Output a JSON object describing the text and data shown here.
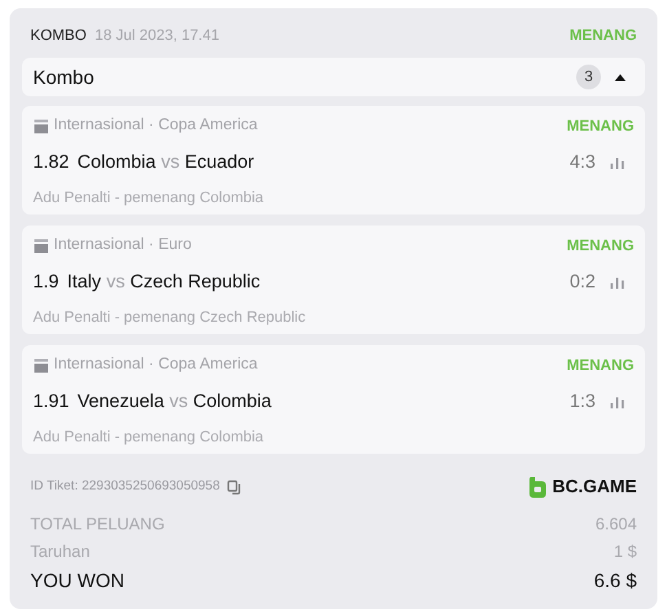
{
  "header": {
    "type": "KOMBO",
    "date": "18 Jul 2023, 17.41",
    "status": "MENANG"
  },
  "combo_bar": {
    "title": "Kombo",
    "count": "3",
    "expanded": true
  },
  "matches": [
    {
      "league": "Internasional · Copa America",
      "status": "MENANG",
      "odds": "1.82",
      "home": "Colombia",
      "vs": "vs",
      "away": "Ecuador",
      "score": "4:3",
      "market": "Adu Penalti - pemenang Colombia"
    },
    {
      "league": "Internasional · Euro",
      "status": "MENANG",
      "odds": "1.9",
      "home": "Italy",
      "vs": "vs",
      "away": "Czech Republic",
      "score": "0:2",
      "market": "Adu Penalti - pemenang Czech Republic"
    },
    {
      "league": "Internasional · Copa America",
      "status": "MENANG",
      "odds": "1.91",
      "home": "Venezuela",
      "vs": "vs",
      "away": "Colombia",
      "score": "1:3",
      "market": "Adu Penalti - pemenang Colombia"
    }
  ],
  "ticket": {
    "label": "ID Tiket: 2293035250693050958",
    "brand": "BC.GAME"
  },
  "totals": [
    {
      "kind": "muted",
      "label": "TOTAL PELUANG",
      "value": "6.604"
    },
    {
      "kind": "muted",
      "label": "Taruhan",
      "value": "1 $"
    },
    {
      "kind": "strong",
      "label": "YOU WON",
      "value": "6.6 $"
    }
  ]
}
